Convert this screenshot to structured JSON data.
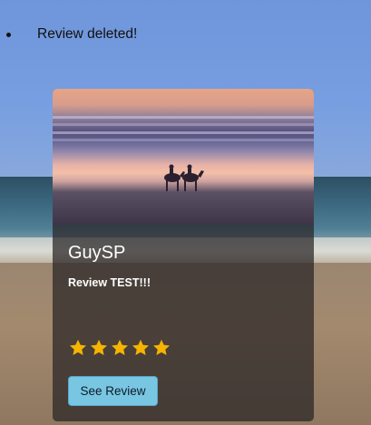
{
  "messages": [
    "Review deleted!"
  ],
  "review_card": {
    "reviewer": "GuySP",
    "text": "Review TEST!!!",
    "rating": 5,
    "rating_max": 5,
    "button_label": "See Review",
    "image_icon": "camels-on-beach-photo"
  },
  "colors": {
    "star": "#f5b400",
    "button_bg": "#79c6e3",
    "card_bg": "rgba(40,36,38,0.72)"
  }
}
